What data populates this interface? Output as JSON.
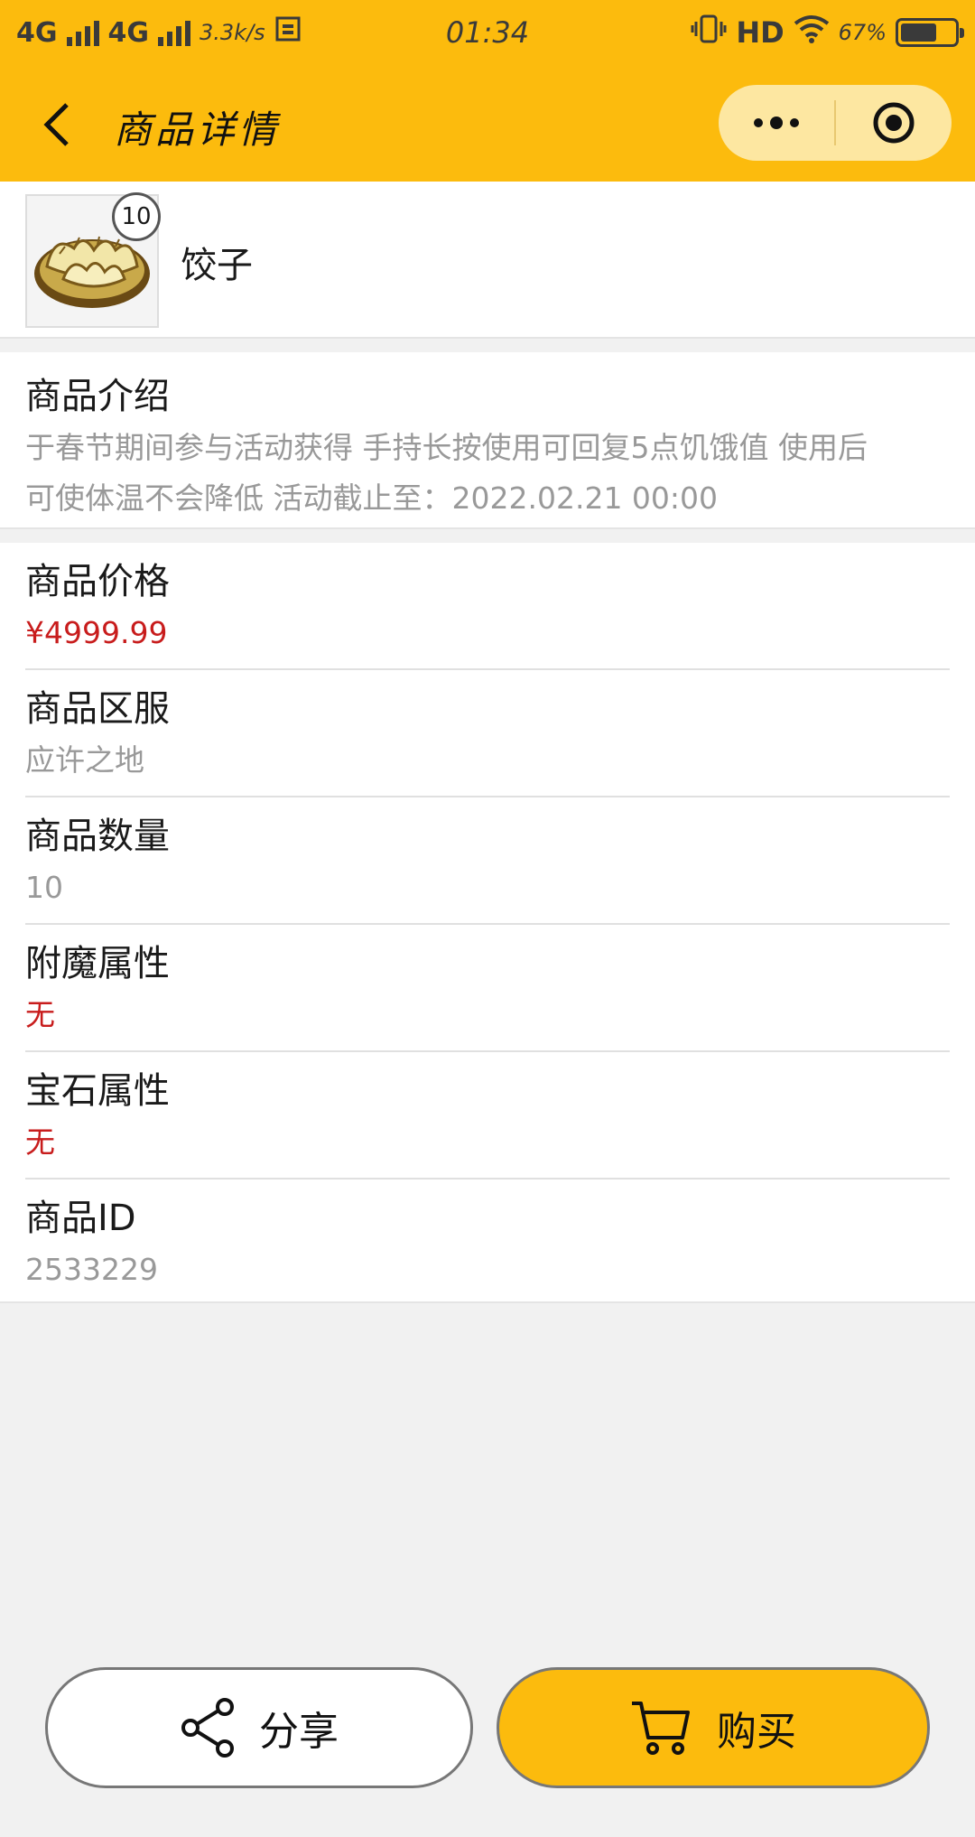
{
  "status_bar": {
    "network1": "4G",
    "network2": "4G",
    "speed": "3.3k/s",
    "time": "01:34",
    "hd": "HD",
    "battery": "67%",
    "battery_level": 0.67
  },
  "nav": {
    "title": "商品详情"
  },
  "product": {
    "name": "饺子",
    "count_badge": "10"
  },
  "description": {
    "label": "商品介绍",
    "line1": "于春节期间参与活动获得 手持长按使用可回复5点饥饿值 使用后",
    "line2": "可使体温不会降低 活动截止至：2022.02.21 00:00"
  },
  "info_rows": [
    {
      "label": "商品价格",
      "value": "¥4999.99",
      "highlight": true
    },
    {
      "label": "商品区服",
      "value": "应许之地",
      "highlight": false
    },
    {
      "label": "商品数量",
      "value": "10",
      "highlight": false
    },
    {
      "label": "附魔属性",
      "value": "无",
      "highlight": true
    },
    {
      "label": "宝石属性",
      "value": "无",
      "highlight": true
    },
    {
      "label": "商品ID",
      "value": "2533229",
      "highlight": false
    }
  ],
  "buttons": {
    "share": "分享",
    "buy": "购买"
  },
  "colors": {
    "accent": "#fcbb0d",
    "price_red": "#c81c1c",
    "muted_text": "#999999"
  },
  "icons": {
    "back": "chevron-left-icon",
    "more": "more-dots-icon",
    "close": "target-circle-icon",
    "share": "share-icon",
    "cart": "cart-icon"
  }
}
